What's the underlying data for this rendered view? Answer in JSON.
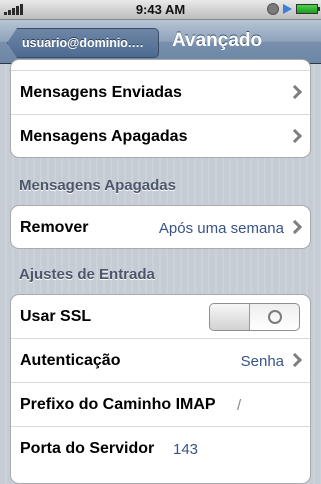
{
  "status_bar": {
    "time": "9:43 AM"
  },
  "nav": {
    "back_label": "usuario@dominio.co...",
    "title": "Avançado"
  },
  "group_mailboxes": {
    "items": [
      {
        "label": "Mensagens Enviadas"
      },
      {
        "label": "Mensagens Apagadas"
      }
    ]
  },
  "section_deleted": {
    "header": "Mensagens Apagadas",
    "remove_label": "Remover",
    "remove_value": "Após uma semana"
  },
  "section_incoming": {
    "header": "Ajustes de Entrada",
    "ssl_label": "Usar SSL",
    "ssl_on": false,
    "auth_label": "Autenticação",
    "auth_value": "Senha",
    "imap_prefix_label": "Prefixo do Caminho IMAP",
    "imap_prefix_value": "/",
    "port_label": "Porta do Servidor",
    "port_value": "143"
  },
  "colors": {
    "background": "#c5ccd4",
    "value_text": "#385487",
    "section_header": "#4c566c"
  }
}
